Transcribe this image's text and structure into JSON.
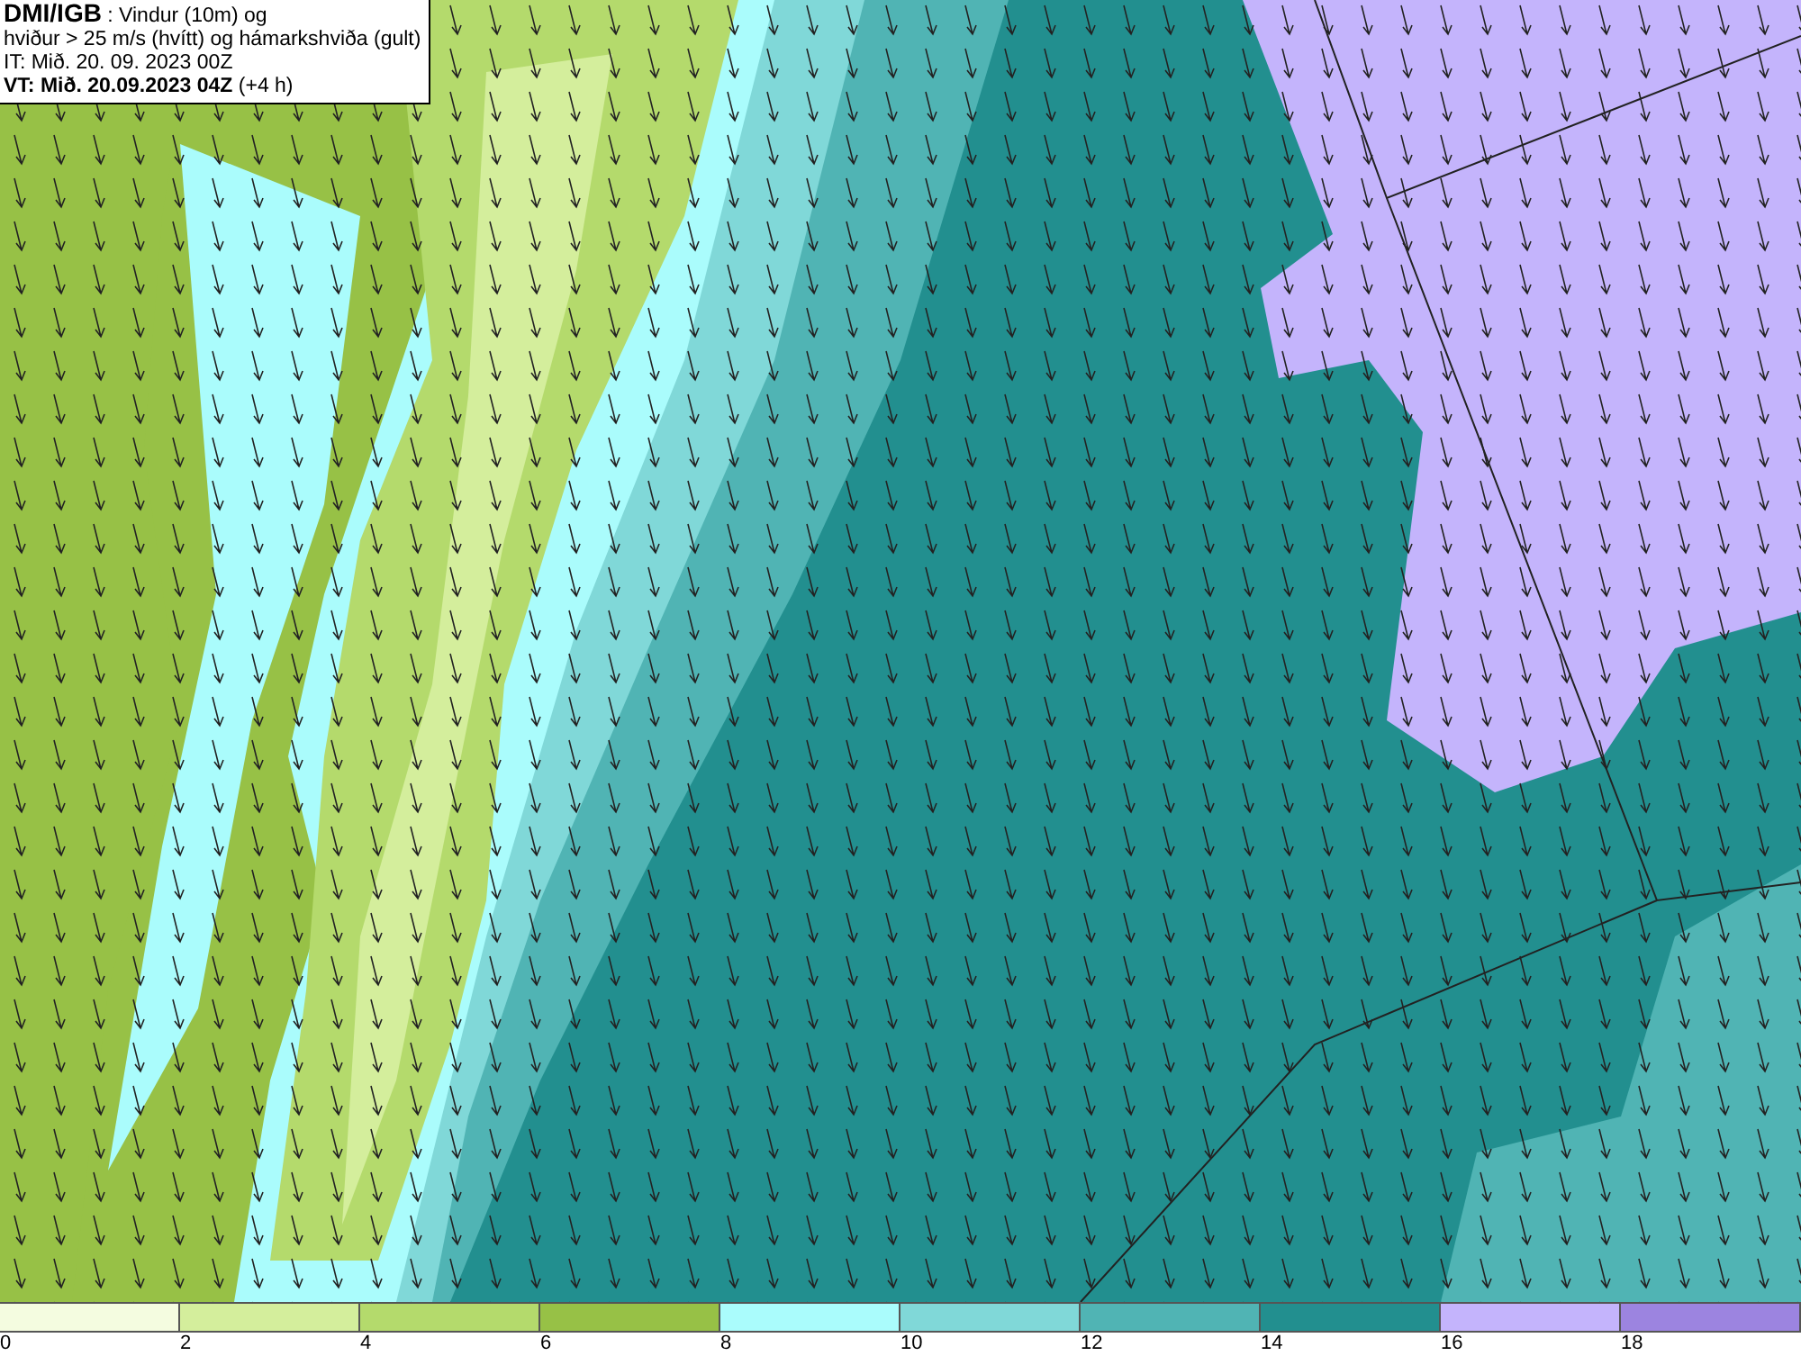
{
  "info_box": {
    "lines": [
      "**DMI/IGB** : Vindur (10m) og",
      "hviður > 25 m/s (hvítt) og hámarkshviða (gult)",
      "IT: Mið. 20. 09. 2023 00Z",
      "**VT: Mið. 20.09.2023 04Z** (+4 h)"
    ]
  },
  "legend": {
    "bins": [
      {
        "label": "0",
        "color": "#f4fce0"
      },
      {
        "label": "2",
        "color": "#d4ee9c"
      },
      {
        "label": "4",
        "color": "#b4da6c"
      },
      {
        "label": "6",
        "color": "#97c146"
      },
      {
        "label": "8",
        "color": "#aafcfc"
      },
      {
        "label": "10",
        "color": "#80d8d8"
      },
      {
        "label": "12",
        "color": "#50b4b4"
      },
      {
        "label": "14",
        "color": "#228f8f"
      },
      {
        "label": "16",
        "color": "#c4b4fc"
      },
      {
        "label": "18",
        "color": "#9c84e0"
      }
    ]
  }
}
